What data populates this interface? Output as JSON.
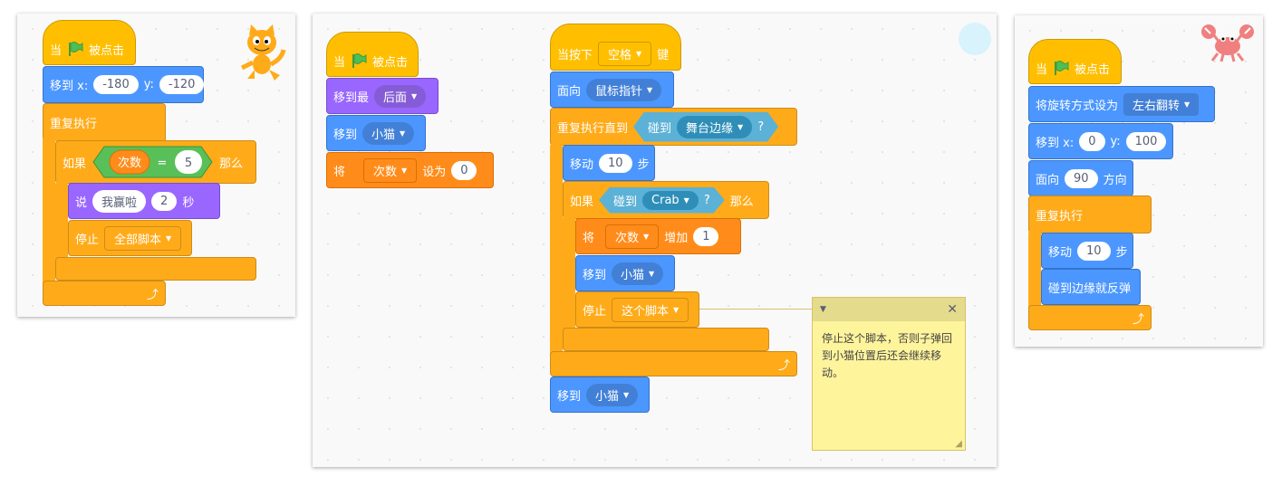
{
  "blocks": {
    "when_flag_clicked": {
      "pre": "当",
      "post": "被点击"
    },
    "go_to_xy": {
      "label": "移到 x:",
      "ylabel": "y:"
    },
    "forever": "重复执行",
    "if": "如果",
    "then": "那么",
    "say": "说",
    "seconds": "秒",
    "stop": "停止",
    "go_to": "移到",
    "go_to_layer": "移到最",
    "set": "将",
    "set_to": "设为",
    "when_key": {
      "pre": "当按下",
      "post": "键"
    },
    "point_towards": "面向",
    "repeat_until": "重复执行直到",
    "touching": "碰到",
    "move": "移动",
    "steps": "步",
    "change_by": "增加",
    "set_rotation": "将旋转方式设为",
    "point_direction": "面向",
    "direction_suffix": "方向",
    "bounce": "碰到边缘就反弹"
  },
  "script1": {
    "x": "-180",
    "y": "-120",
    "var": "次数",
    "equals": "=",
    "eq_value": "5",
    "say_text": "我赢啦",
    "say_secs": "2",
    "stop_option": "全部脚本"
  },
  "script2": {
    "layer": "后面",
    "goto_target": "小猫",
    "var": "次数",
    "set_value": "0"
  },
  "script3": {
    "key": "空格",
    "point_target": "鼠标指针",
    "until_target": "舞台边缘",
    "move_steps": "10",
    "if_target": "Crab",
    "change_var": "次数",
    "change_value": "1",
    "goto_target": "小猫",
    "stop_option": "这个脚本",
    "final_goto": "小猫"
  },
  "script4": {
    "rotation_style": "左右翻转",
    "x": "0",
    "y": "100",
    "direction": "90",
    "move_steps": "10"
  },
  "comment": {
    "text": "停止这个脚本，否则子弹回到小猫位置后还会继续移动。"
  },
  "icons": {
    "flag": "green-flag-icon",
    "loop": "loop-arrow-icon",
    "caret": "dropdown-caret-icon",
    "question": "?"
  },
  "colors": {
    "events": "#ffbf00",
    "motion": "#4c97ff",
    "looks": "#9966ff",
    "control": "#ffab19",
    "variables": "#ff8c1a",
    "sensing": "#5cb1d6",
    "operators": "#59c059"
  }
}
